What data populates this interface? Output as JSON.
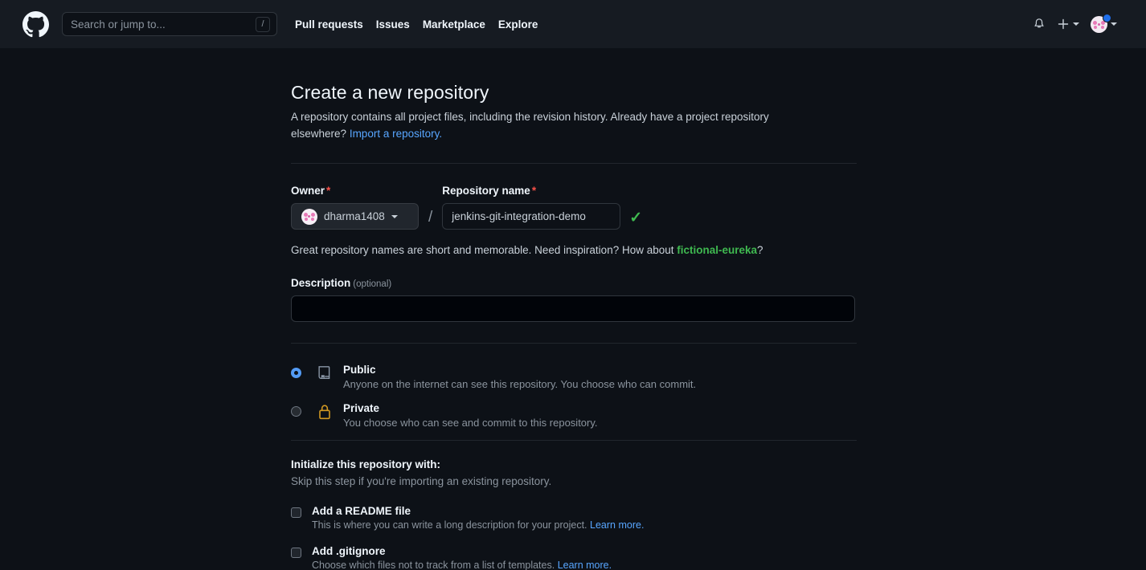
{
  "header": {
    "logo_icon": "github-mark-icon",
    "search": {
      "placeholder": "Search or jump to...",
      "value": "",
      "shortcut_badge": "/"
    },
    "nav": [
      {
        "label": "Pull requests"
      },
      {
        "label": "Issues"
      },
      {
        "label": "Marketplace"
      },
      {
        "label": "Explore"
      }
    ],
    "notifications_icon": "bell-icon",
    "create_new_icon": "plus-icon",
    "create_new_caret_icon": "chevron-down-icon",
    "avatar_icon": "user-avatar",
    "avatar_caret_icon": "chevron-down-icon",
    "has_unread_notification": true
  },
  "page": {
    "title": "Create a new repository",
    "description_part1": "A repository contains all project files, including the revision history. Already have a project repository elsewhere?",
    "import_link": "Import a repository."
  },
  "owner": {
    "label": "Owner",
    "required_marker": "*",
    "selected": "dharma1408",
    "caret_icon": "chevron-down-icon",
    "separator": "/"
  },
  "repository_name": {
    "label": "Repository name",
    "required_marker": "*",
    "value": "jenkins-git-integration-demo",
    "valid_icon": "check-icon",
    "valid": true
  },
  "name_hint": {
    "prefix": "Great repository names are short and memorable. Need inspiration? How about",
    "suggestion": "fictional-eureka",
    "suffix": "?"
  },
  "description": {
    "label": "Description",
    "optional_tag": "(optional)",
    "value": "",
    "placeholder": ""
  },
  "visibility": {
    "options": [
      {
        "id": "public",
        "title": "Public",
        "subtitle": "Anyone on the internet can see this repository. You choose who can commit.",
        "icon": "repo-icon",
        "selected": true
      },
      {
        "id": "private",
        "title": "Private",
        "subtitle": "You choose who can see and commit to this repository.",
        "icon": "lock-icon",
        "selected": false
      }
    ]
  },
  "initialize": {
    "title": "Initialize this repository with:",
    "subtitle": "Skip this step if you're importing an existing repository.",
    "options": [
      {
        "id": "readme",
        "label": "Add a README file",
        "sub_prefix": "This is where you can write a long description for your project.",
        "learn_more": "Learn more.",
        "checked": false
      },
      {
        "id": "gitignore",
        "label": "Add .gitignore",
        "sub_prefix": "Choose which files not to track from a list of templates.",
        "learn_more": "Learn more.",
        "checked": false
      }
    ]
  },
  "colors": {
    "background": "#0d1117",
    "header_bg": "#161b22",
    "accent_blue": "#58a6ff",
    "success_green": "#3fb950",
    "warning_orange": "#d29922",
    "required_red": "#f85149"
  }
}
